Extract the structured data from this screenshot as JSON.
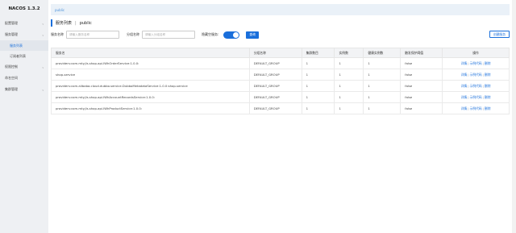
{
  "sidebar": {
    "brand": "NACOS 1.3.2",
    "items": [
      {
        "label": "配置管理",
        "has_chevron": true
      },
      {
        "label": "服务管理",
        "has_chevron": true
      },
      {
        "label": "服务列表",
        "sub": true,
        "active": true
      },
      {
        "label": "订阅者列表",
        "sub": true
      },
      {
        "label": "权限控制",
        "has_chevron": true
      },
      {
        "label": "命名空间"
      },
      {
        "label": "集群管理",
        "has_chevron": true
      }
    ]
  },
  "breadcrumb": {
    "text": "public"
  },
  "header": {
    "title": "服务列表",
    "namespace": "public"
  },
  "filters": {
    "service_name_label": "服务名称",
    "service_name_placeholder": "请输入服务名称",
    "group_name_label": "分组名称",
    "group_name_placeholder": "请输入分组名称",
    "hide_empty_label": "隐藏空服务:",
    "search_label": "查询",
    "create_label": "创建服务"
  },
  "table": {
    "headers": [
      "服务名",
      "分组名称",
      "集群数目",
      "实例数",
      "健康实例数",
      "触发保护阈值",
      "操作"
    ],
    "rows": [
      {
        "name": "providers:com.mty.jls.shop.api.IWhOrderService:1.0.0:",
        "group": "DEFAULT_GROUP",
        "clusters": "1",
        "instances": "1",
        "healthy": "1",
        "threshold": "false"
      },
      {
        "name": "shop-service",
        "group": "DEFAULT_GROUP",
        "clusters": "1",
        "instances": "1",
        "healthy": "1",
        "threshold": "false"
      },
      {
        "name": "providers:com.alibaba.cloud.dubbo.service.DubboMetadataService:1.0.0:shop-service",
        "group": "DEFAULT_GROUP",
        "clusters": "1",
        "instances": "1",
        "healthy": "1",
        "threshold": "false"
      },
      {
        "name": "providers:com.mty.jls.shop.api.IWhAccountRecordsService:1.0.0:",
        "group": "DEFAULT_GROUP",
        "clusters": "1",
        "instances": "1",
        "healthy": "1",
        "threshold": "false"
      },
      {
        "name": "providers:com.mty.jls.shop.api.IWhProductService:1.0.0:",
        "group": "DEFAULT_GROUP",
        "clusters": "1",
        "instances": "1",
        "healthy": "1",
        "threshold": "false"
      }
    ],
    "op_labels": {
      "detail": "详情",
      "sample": "示例代码",
      "delete": "删除"
    }
  },
  "colors": {
    "accent": "#1a6fdb",
    "sidebar_bg": "#eef0f3",
    "breadcrumb_bg": "#eaf1f8"
  }
}
